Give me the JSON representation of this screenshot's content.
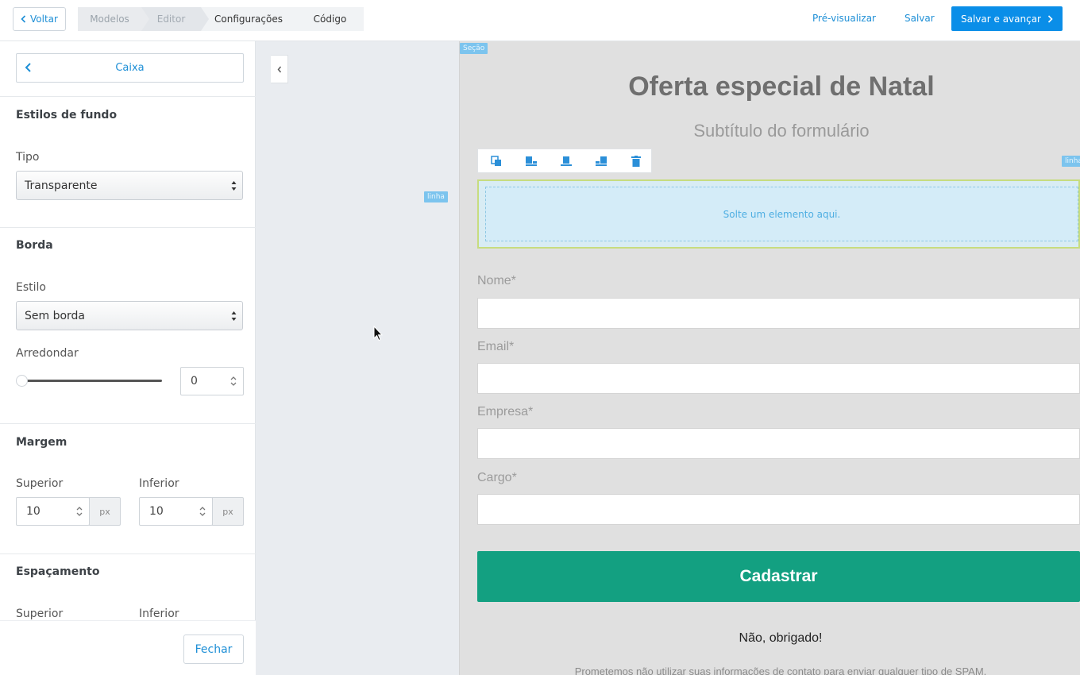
{
  "topbar": {
    "back_label": "Voltar",
    "steps": [
      "Modelos",
      "Editor",
      "Configurações",
      "Código"
    ],
    "preview_label": "Pré-visualizar",
    "save_label": "Salvar",
    "save_next_label": "Salvar e avançar"
  },
  "sidebar": {
    "header_button": "Caixa",
    "background": {
      "title": "Estilos de fundo",
      "type_label": "Tipo",
      "type_value": "Transparente"
    },
    "border": {
      "title": "Borda",
      "style_label": "Estilo",
      "style_value": "Sem borda",
      "round_label": "Arredondar",
      "round_value": "0"
    },
    "margin": {
      "title": "Margem",
      "top_label": "Superior",
      "top_value": "10",
      "bottom_label": "Inferior",
      "bottom_value": "10",
      "unit": "px"
    },
    "spacing": {
      "title": "Espaçamento",
      "top_label": "Superior",
      "bottom_label": "Inferior"
    },
    "close_label": "Fechar"
  },
  "canvas": {
    "section_tag": "Seção",
    "line_tag": "linha",
    "right_tag": "linha",
    "form_title": "Oferta especial de Natal",
    "form_subtitle": "Subtítulo do formulário",
    "drop_zone_text": "Solte um elemento aqui.",
    "fields": [
      "Nome*",
      "Email*",
      "Empresa*",
      "Cargo*"
    ],
    "submit_label": "Cadastrar",
    "no_thanks": "Não, obrigado!",
    "privacy": "Prometemos não utilizar suas informações de contato para enviar qualquer tipo de SPAM."
  },
  "colors": {
    "accent": "#0a8ee8",
    "link": "#1e8fd6",
    "submit": "#13a081",
    "drop_zone": "#d4ecf8"
  }
}
